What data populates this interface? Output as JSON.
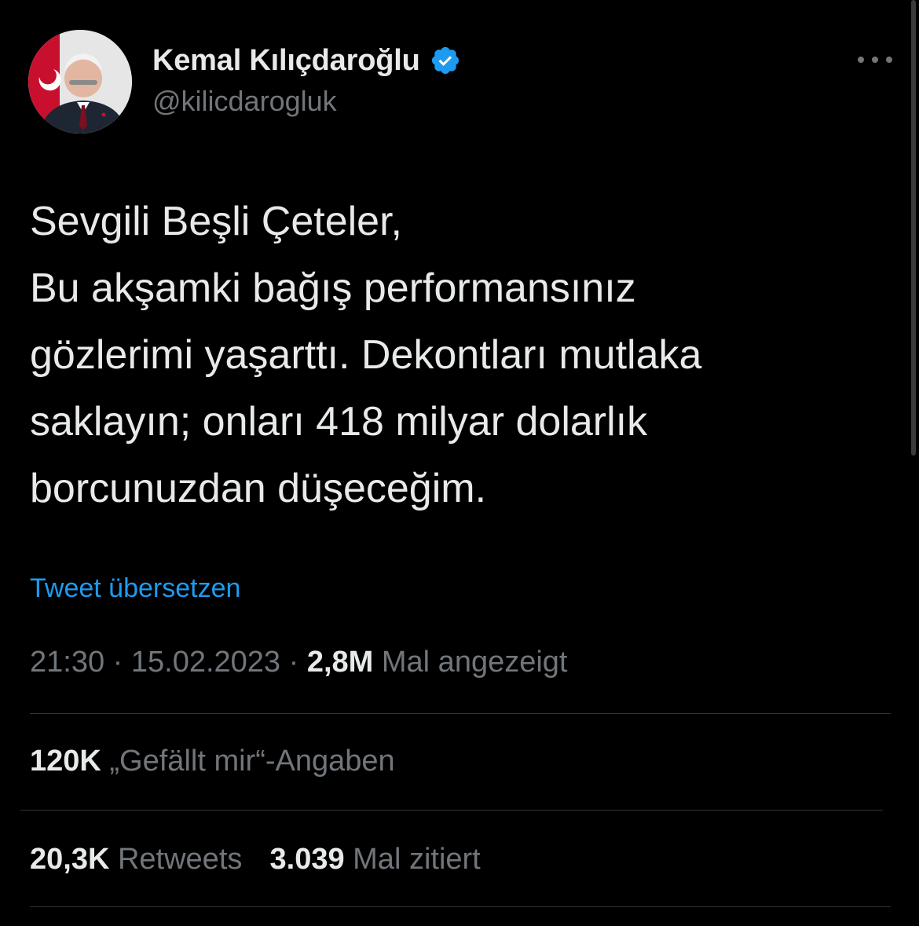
{
  "author": {
    "display_name": "Kemal Kılıçdaroğlu",
    "handle": "@kilicdarogluk",
    "verified": true,
    "verified_color": "#1d9bf0"
  },
  "icons": {
    "avatar": "profile-photo",
    "verified": "verified-badge-icon",
    "more": "more-horizontal-icon"
  },
  "tweet": {
    "text": "Sevgili Beşli Çeteler,\nBu akşamki bağış performansınız\ngözlerimi yaşarttı. Dekontları mutlaka\nsaklayın; onları 418 milyar dolarlık\nborcunuzdan düşeceğim.",
    "translate_label": "Tweet übersetzen"
  },
  "meta": {
    "time": "21:30",
    "separator": "·",
    "date": "15.02.2023",
    "views": "2,8M",
    "views_label": "Mal angezeigt"
  },
  "stats": {
    "likes": "120K",
    "likes_label": "„Gefällt mir“-Angaben",
    "retweets": "20,3K",
    "retweets_label": "Retweets",
    "quotes": "3.039",
    "quotes_label": "Mal zitiert"
  },
  "colors": {
    "background": "#000000",
    "text_primary": "#e7e9ea",
    "text_secondary": "#71767b",
    "link": "#1d9bf0",
    "divider": "#2f3336"
  }
}
